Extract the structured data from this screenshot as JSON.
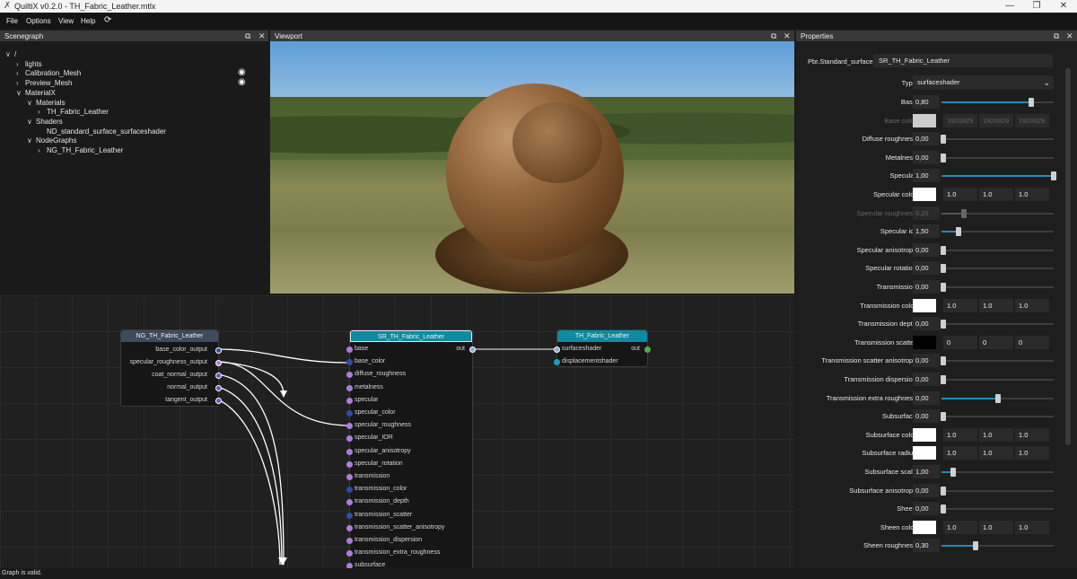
{
  "window": {
    "title": "QuiltiX v0.2.0 - TH_Fabric_Leather.mtlx",
    "minimize": "—",
    "restore": "❐",
    "close": "✕"
  },
  "menu": [
    {
      "label": "File"
    },
    {
      "label": "Options"
    },
    {
      "label": "View"
    },
    {
      "label": "Help"
    },
    {
      "label": "⟳"
    }
  ],
  "panels": {
    "scenegraph": "Scenegraph",
    "viewport": "Viewport",
    "properties": "Properties",
    "float_icon": "⧉",
    "close_icon": "✕"
  },
  "scenegraph": {
    "items": [
      {
        "label": "/",
        "chev": "∨",
        "indent": 0,
        "eye": false
      },
      {
        "label": "lights",
        "chev": "›",
        "indent": 1,
        "eye": false
      },
      {
        "label": "Calibration_Mesh",
        "chev": "›",
        "indent": 1,
        "eye": true
      },
      {
        "label": "Preview_Mesh",
        "chev": "›",
        "indent": 1,
        "eye": true
      },
      {
        "label": "MaterialX",
        "chev": "∨",
        "indent": 1,
        "eye": false
      },
      {
        "label": "Materials",
        "chev": "∨",
        "indent": 2,
        "eye": false
      },
      {
        "label": "TH_Fabric_Leather",
        "chev": "›",
        "indent": 3,
        "eye": false
      },
      {
        "label": "Shaders",
        "chev": "∨",
        "indent": 2,
        "eye": false
      },
      {
        "label": "ND_standard_surface_surfaceshader",
        "chev": "",
        "indent": 3,
        "eye": false
      },
      {
        "label": "NodeGraphs",
        "chev": "∨",
        "indent": 2,
        "eye": false
      },
      {
        "label": "NG_TH_Fabric_Leather",
        "chev": "›",
        "indent": 3,
        "eye": false
      }
    ]
  },
  "nodes": {
    "nodegraph": {
      "title": "NG_TH_Fabric_Leather",
      "outputs": [
        "base_color_output",
        "specular_roughness_output",
        "coat_normal_output",
        "normal_output",
        "tangent_output"
      ]
    },
    "shader": {
      "title": "SR_TH_Fabric_Leather",
      "out_label": "out",
      "inputs": [
        "base",
        "base_color",
        "diffuse_roughness",
        "metalness",
        "specular",
        "specular_color",
        "specular_roughness",
        "specular_IOR",
        "specular_anisotropy",
        "specular_rotation",
        "transmission",
        "transmission_color",
        "transmission_depth",
        "transmission_scatter",
        "transmission_scatter_anisotropy",
        "transmission_dispersion",
        "transmission_extra_roughness",
        "subsurface"
      ]
    },
    "material": {
      "title": "TH_Fabric_Leather",
      "out_label": "out",
      "inputs": [
        "surfaceshader",
        "displacementshader"
      ]
    }
  },
  "properties": {
    "node_type": "Pbr.Standard_surface",
    "node_name": "SR_TH_Fabric_Leather",
    "type_label": "Type:",
    "type_value": "surfaceshader",
    "rows": [
      {
        "label": "Base:",
        "kind": "slider",
        "value": "0,80",
        "frac": 0.8,
        "dim": false
      },
      {
        "label": "Base color:",
        "kind": "color",
        "swatch": "#cccccc",
        "c": [
          "1920929",
          "1920929",
          "1920929"
        ],
        "dim": true
      },
      {
        "label": "Diffuse roughness:",
        "kind": "slider",
        "value": "0,00",
        "frac": 0.0,
        "dim": false
      },
      {
        "label": "Metalness:",
        "kind": "slider",
        "value": "0,00",
        "frac": 0.0,
        "dim": false
      },
      {
        "label": "Specular:",
        "kind": "slider",
        "value": "1,00",
        "frac": 1.0,
        "dim": false
      },
      {
        "label": "Specular color:",
        "kind": "color",
        "swatch": "#ffffff",
        "c": [
          "1.0",
          "1.0",
          "1.0"
        ],
        "dim": false
      },
      {
        "label": "Specular roughness:",
        "kind": "slider",
        "value": "0,20",
        "frac": 0.2,
        "dim": true
      },
      {
        "label": "Specular ior:",
        "kind": "slider",
        "value": "1,50",
        "frac": 0.15,
        "dim": false
      },
      {
        "label": "Specular anisotropy:",
        "kind": "slider",
        "value": "0,00",
        "frac": 0.0,
        "dim": false
      },
      {
        "label": "Specular rotation:",
        "kind": "slider",
        "value": "0,00",
        "frac": 0.0,
        "dim": false
      },
      {
        "label": "Transmission:",
        "kind": "slider",
        "value": "0,00",
        "frac": 0.0,
        "dim": false
      },
      {
        "label": "Transmission color:",
        "kind": "color",
        "swatch": "#ffffff",
        "c": [
          "1.0",
          "1.0",
          "1.0"
        ],
        "dim": false
      },
      {
        "label": "Transmission depth:",
        "kind": "slider",
        "value": "0,00",
        "frac": 0.0,
        "dim": false
      },
      {
        "label": "Transmission scatter:",
        "kind": "color",
        "swatch": "#000000",
        "c": [
          "0",
          "0",
          "0"
        ],
        "dim": false
      },
      {
        "label": "Transmission scatter anisotropy:",
        "kind": "slider",
        "value": "0,00",
        "frac": 0.0,
        "dim": false
      },
      {
        "label": "Transmission dispersion:",
        "kind": "slider",
        "value": "0,00",
        "frac": 0.0,
        "dim": false
      },
      {
        "label": "Transmission extra roughness:",
        "kind": "slider",
        "value": "0,00",
        "frac": 0.5,
        "dim": false
      },
      {
        "label": "Subsurface:",
        "kind": "slider",
        "value": "0,00",
        "frac": 0.0,
        "dim": false
      },
      {
        "label": "Subsurface color:",
        "kind": "color",
        "swatch": "#ffffff",
        "c": [
          "1.0",
          "1.0",
          "1.0"
        ],
        "dim": false
      },
      {
        "label": "Subsurface radius:",
        "kind": "color",
        "swatch": "#ffffff",
        "c": [
          "1.0",
          "1.0",
          "1.0"
        ],
        "dim": false
      },
      {
        "label": "Subsurface scale:",
        "kind": "slider",
        "value": "1,00",
        "frac": 0.1,
        "dim": false
      },
      {
        "label": "Subsurface anisotropy:",
        "kind": "slider",
        "value": "0,00",
        "frac": 0.0,
        "dim": false
      },
      {
        "label": "Sheen:",
        "kind": "slider",
        "value": "0,00",
        "frac": 0.0,
        "dim": false
      },
      {
        "label": "Sheen color:",
        "kind": "color",
        "swatch": "#ffffff",
        "c": [
          "1.0",
          "1.0",
          "1.0"
        ],
        "dim": false
      },
      {
        "label": "Sheen roughness:",
        "kind": "slider",
        "value": "0,30",
        "frac": 0.3,
        "dim": false
      }
    ]
  },
  "status": "Graph is valid.",
  "colors": {
    "accent": "#1e8bbd",
    "header_nodegraph": "#3e4a5e",
    "header_teal": "#0f8a9e",
    "pin_purple": "#b07be0",
    "pin_blue": "#2c4ea8"
  }
}
